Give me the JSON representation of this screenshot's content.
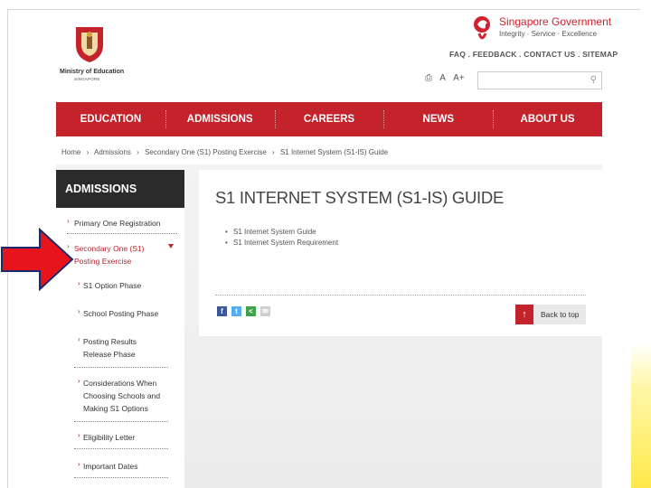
{
  "header": {
    "ministry_name": "Ministry of Education",
    "ministry_sub": "SINGAPORE",
    "gov_title": "Singapore Government",
    "gov_tagline": "Integrity · Service · Excellence",
    "top_links": [
      "FAQ",
      "FEEDBACK",
      "CONTACT US",
      "SITEMAP"
    ],
    "font_tools": [
      "A",
      "A+"
    ],
    "search_placeholder": ""
  },
  "nav": {
    "items": [
      "EDUCATION",
      "ADMISSIONS",
      "CAREERS",
      "NEWS",
      "ABOUT US"
    ]
  },
  "breadcrumb": [
    "Home",
    "Admissions",
    "Secondary One (S1) Posting Exercise",
    "S1 Internet System (S1-IS) Guide"
  ],
  "sidebar": {
    "heading": "ADMISSIONS",
    "items": [
      {
        "label": "Primary One Registration"
      },
      {
        "label_line1": "Secondary One (S1)",
        "label_line2": "Posting Exercise"
      },
      {
        "label": "S1 Option Phase"
      },
      {
        "label": "School Posting Phase"
      },
      {
        "label_line1": "Posting Results",
        "label_line2": "Release Phase"
      },
      {
        "label_line1": "Considerations When",
        "label_line2": "Choosing Schools and",
        "label_line3": "Making S1 Options"
      },
      {
        "label": "Eligibility Letter"
      },
      {
        "label": "Important Dates"
      }
    ]
  },
  "content": {
    "title": "S1 INTERNET SYSTEM (S1-IS) GUIDE",
    "links": [
      "S1 Internet System Guide",
      "S1 Internet System Requirement"
    ],
    "back_to_top": "Back to top"
  },
  "colors": {
    "brand_red": "#c4232c",
    "sidebar_head": "#2b2b2b",
    "annotation_arrow": "#e8141c"
  }
}
